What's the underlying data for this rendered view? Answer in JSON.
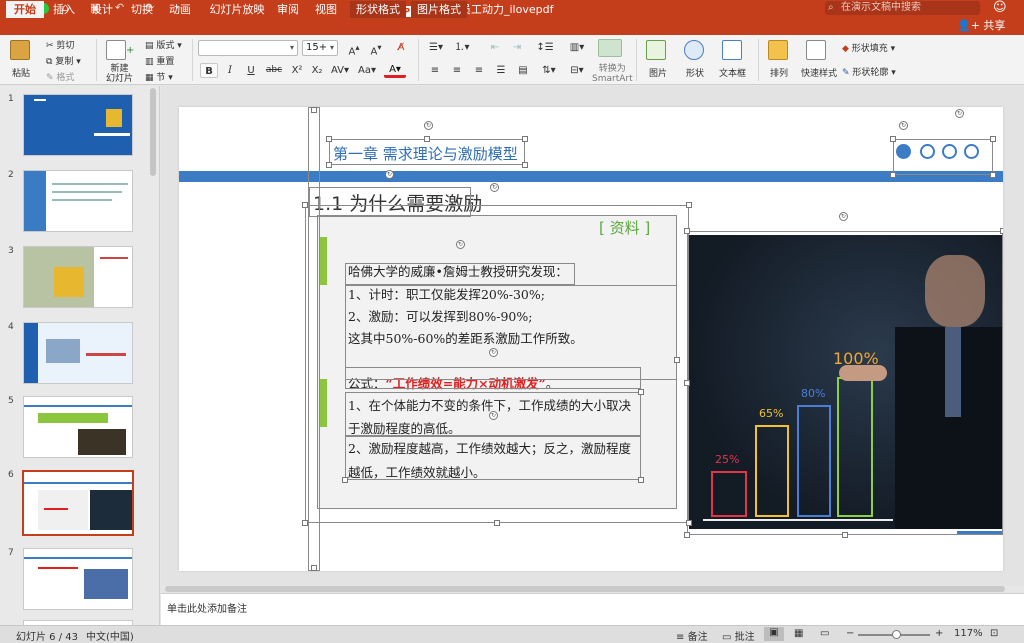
{
  "window": {
    "title": "如何激发员工动力_ilovepdf",
    "search_placeholder": "在演示文稿中搜索"
  },
  "tabs": [
    {
      "label": "开始",
      "active": true
    },
    {
      "label": "插入"
    },
    {
      "label": "设计"
    },
    {
      "label": "切换"
    },
    {
      "label": "动画"
    },
    {
      "label": "幻灯片放映"
    },
    {
      "label": "审阅"
    },
    {
      "label": "视图"
    },
    {
      "label": "形状格式",
      "contextual": true
    },
    {
      "label": "图片格式",
      "contextual": true
    }
  ],
  "share_label": "共享",
  "ribbon": {
    "paste": "粘贴",
    "cut": "剪切",
    "copy": "复制",
    "format": "格式",
    "new_slide": "新建\n幻灯片",
    "layout": "版式",
    "reset": "重置",
    "section": "节",
    "font_name": "",
    "font_size": "15+",
    "bold": "B",
    "italic": "I",
    "underline": "U",
    "strike": "abc",
    "superscript": "X²",
    "subscript": "X₂",
    "convert_smartart": "转换为\nSmartArt",
    "picture": "图片",
    "shape": "形状",
    "textbox": "文本框",
    "arrange": "排列",
    "quick_styles": "快速样式",
    "shape_fill": "形状填充",
    "shape_outline": "形状轮廓"
  },
  "thumbnails": [
    "1",
    "2",
    "3",
    "4",
    "5",
    "6",
    "7"
  ],
  "selected_slide": 6,
  "slide": {
    "chapter_title": "第一章 需求理论与激励模型",
    "section_title": "1.1 为什么需要激励",
    "tag": "[ 资料 ]",
    "lines_block1": [
      "哈佛大学的威廉•詹姆士教授研究发现：",
      "1、计时：职工仅能发挥20%-30%;",
      "2、激励：可以发挥到80%-90%;",
      "这其中50%-60%的差距系激励工作所致。"
    ],
    "formula_prefix": "公式：",
    "formula_red": "“工作绩效=能力×动机激发”",
    "formula_suffix": "。",
    "lines_block2": [
      "1、在个体能力不变的条件下，工作成绩的大小取决",
      "于激励程度的高低。",
      "2、激励程度越高，工作绩效越大；反之，激励程度",
      "越低，工作绩效就越小。"
    ],
    "chart_labels": [
      "25%",
      "65%",
      "80%",
      "100%"
    ]
  },
  "notes_placeholder": "单击此处添加备注",
  "status": {
    "slide_counter": "幻灯片 6 / 43",
    "language": "中文(中国)",
    "notes": "备注",
    "comments": "批注",
    "zoom": "117%"
  },
  "colors": {
    "accent": "#c43e1c",
    "slide_blue": "#3b7cc4",
    "green_bar": "#8cc63f",
    "formula_red": "#e02020",
    "tag_green": "#5aa83a"
  }
}
